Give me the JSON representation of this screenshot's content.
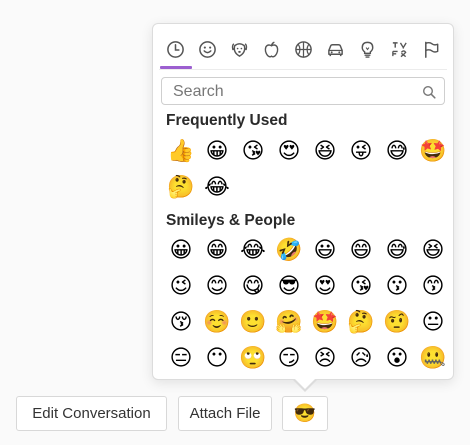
{
  "picker": {
    "tabs": [
      {
        "icon": "clock-icon",
        "active": true
      },
      {
        "icon": "smiley-icon"
      },
      {
        "icon": "dog-icon"
      },
      {
        "icon": "apple-icon"
      },
      {
        "icon": "basketball-icon"
      },
      {
        "icon": "car-icon"
      },
      {
        "icon": "lightbulb-icon"
      },
      {
        "icon": "symbols-icon"
      },
      {
        "icon": "flag-icon"
      }
    ],
    "accent_color": "#9c5fd0",
    "search": {
      "placeholder": "Search",
      "value": ""
    },
    "sections": [
      {
        "title": "Frequently Used",
        "emojis": [
          "👍",
          "😀",
          "😘",
          "😍",
          "😆",
          "😜",
          "😅",
          "🤩",
          "🤔",
          "😂"
        ]
      },
      {
        "title": "Smileys & People",
        "emojis": [
          "😀",
          "😁",
          "😂",
          "🤣",
          "😃",
          "😄",
          "😅",
          "😆",
          "😉",
          "😊",
          "😋",
          "😎",
          "😍",
          "😘",
          "😗",
          "😙",
          "😚",
          "☺️",
          "🙂",
          "🤗",
          "🤩",
          "🤔",
          "🤨",
          "😐",
          "😑",
          "😶",
          "🙄",
          "😏",
          "😣",
          "😥",
          "😮",
          "🤐"
        ]
      }
    ]
  },
  "buttons": {
    "edit_conversation": "Edit Conversation",
    "attach_file": "Attach File",
    "emoji_toggle": "😎"
  }
}
